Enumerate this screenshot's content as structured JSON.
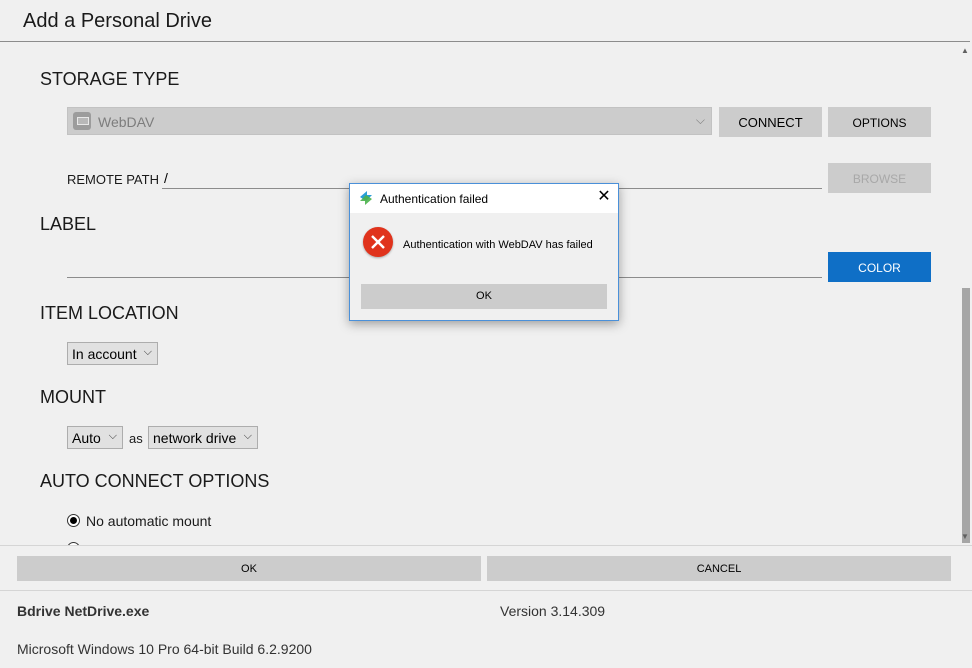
{
  "window": {
    "title": "Add a Personal Drive"
  },
  "storage": {
    "heading": "STORAGE TYPE",
    "selected": "WebDAV",
    "icon": "webdav-icon",
    "connect_label": "CONNECT",
    "options_label": "OPTIONS"
  },
  "remote": {
    "label": "REMOTE PATH",
    "value": "/",
    "browse_label": "BROWSE"
  },
  "label_section": {
    "heading": "LABEL",
    "value": "",
    "color_label": "COLOR"
  },
  "item_location": {
    "heading": "ITEM LOCATION",
    "selected": "In account"
  },
  "mount": {
    "heading": "MOUNT",
    "mode": "Auto",
    "as_text": "as",
    "type": "network drive"
  },
  "auto_connect": {
    "heading": "AUTO CONNECT OPTIONS",
    "options": [
      {
        "label": "No automatic mount",
        "checked": true
      }
    ]
  },
  "actions": {
    "ok_label": "OK",
    "cancel_label": "CANCEL"
  },
  "footer": {
    "app_name": "Bdrive NetDrive.exe",
    "version": "Version 3.14.309",
    "os": "Microsoft Windows 10 Pro 64-bit Build 6.2.9200"
  },
  "dialog": {
    "title": "Authentication failed",
    "message": "Authentication with WebDAV has failed",
    "ok_label": "OK",
    "close_glyph": "✕"
  },
  "colors": {
    "accent": "#0f6fc6",
    "error": "#e0331c",
    "dialog_border": "#4a90d9"
  }
}
